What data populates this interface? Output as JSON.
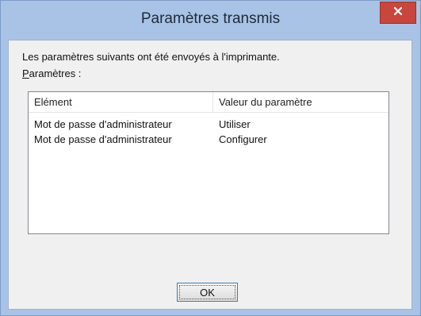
{
  "window": {
    "title": "Paramètres transmis",
    "close_icon": "close-icon"
  },
  "dialog": {
    "intro_text": "Les paramètres suivants ont été envoyés à l'imprimante.",
    "settings_label_first": "P",
    "settings_label_rest": "aramètres :"
  },
  "list": {
    "columns": [
      "Elément",
      "Valeur du paramètre"
    ],
    "rows": [
      {
        "element": "Mot de passe d'administrateur",
        "value": "Utiliser"
      },
      {
        "element": "Mot de passe d'administrateur",
        "value": "Configurer"
      }
    ]
  },
  "buttons": {
    "ok_label": "OK"
  },
  "colors": {
    "frame": "#a8c3e6",
    "close": "#c9463d",
    "client": "#f0f0f0"
  }
}
